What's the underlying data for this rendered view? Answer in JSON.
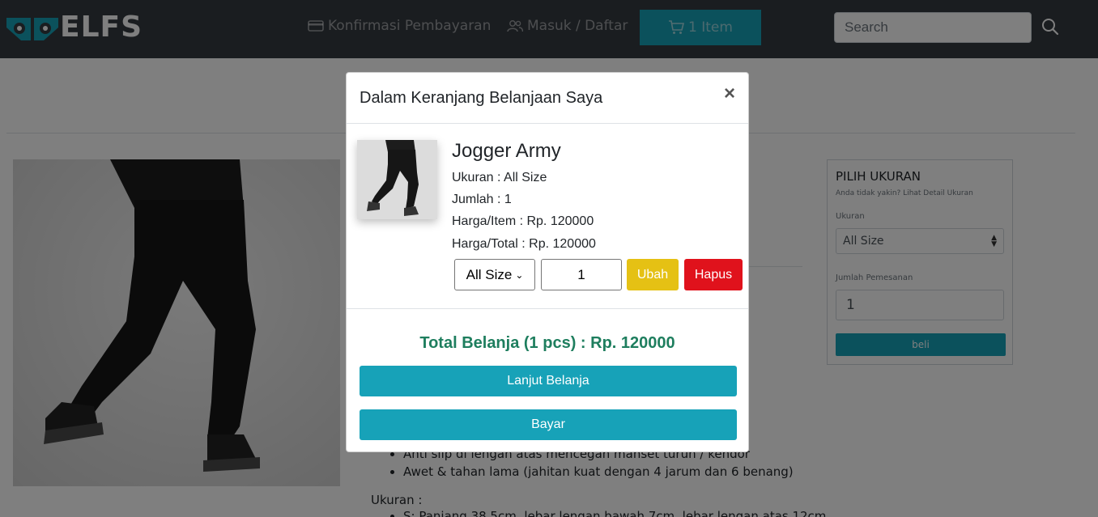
{
  "navbar": {
    "logo_text": "ELFS",
    "confirm_label": "Konfirmasi Pembayaran",
    "login_label": "Masuk / Daftar",
    "cart_label": "1 Item",
    "search_placeholder": "Search"
  },
  "background_page": {
    "bullets": [
      "Anti slip di lengan atas mencegah manset turun / kendor",
      "Awet & tahan lama (jahitan kuat dengan 4 jarum dan 6 benang)"
    ],
    "size_heading": "Ukuran :",
    "size_list_first": "S: Panjang 38.5cm, lebar lengan bawah 7cm, lebar lengan atas 12cm",
    "size_panel": {
      "title": "PILIH UKURAN",
      "help_text": "Anda tidak yakin? Lihat Detail Ukuran",
      "size_label": "Ukuran",
      "size_value": "All Size",
      "qty_label": "Jumlah Pemesanan",
      "qty_value": "1",
      "buy_label": "beli"
    }
  },
  "modal": {
    "title": "Dalam Keranjang Belanjaan Saya",
    "close_label": "×",
    "item": {
      "name": "Jogger Army",
      "size_line": "Ukuran : All Size",
      "qty_line": "Jumlah : 1",
      "price_line": "Harga/Item : Rp. 120000",
      "total_line": "Harga/Total : Rp. 120000",
      "size_select_value": "All Size",
      "qty_value": "1",
      "update_label": "Ubah",
      "delete_label": "Hapus"
    },
    "total_text": "Total Belanja (1 pcs) : Rp. 120000",
    "continue_label": "Lanjut Belanja",
    "pay_label": "Bayar"
  },
  "colors": {
    "navbar_bg": "#343a40",
    "accent": "#17a2b8",
    "update_btn": "#e5c114",
    "delete_btn": "#e0121c",
    "total_text": "#1e7e5e"
  }
}
